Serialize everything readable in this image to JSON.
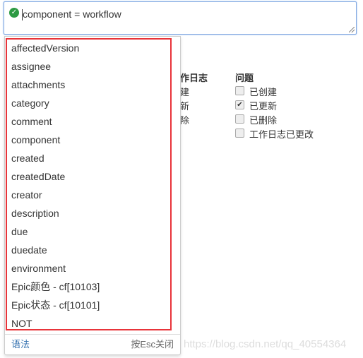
{
  "query": {
    "value": "component = workflow",
    "status_icon": "check-circle-icon",
    "status_color": "#2d9a43"
  },
  "background": {
    "worklog": {
      "header": "作日志",
      "items": [
        "建",
        "新",
        "除"
      ]
    },
    "issue": {
      "header": "问题",
      "items": [
        {
          "label": "已创建",
          "checked": false
        },
        {
          "label": "已更新",
          "checked": true
        },
        {
          "label": "已删除",
          "checked": false
        },
        {
          "label": "工作日志已更改",
          "checked": false
        }
      ]
    }
  },
  "suggestions": {
    "items": [
      "affectedVersion",
      "assignee",
      "attachments",
      "category",
      "comment",
      "component",
      "created",
      "createdDate",
      "creator",
      "description",
      "due",
      "duedate",
      "environment",
      "Epic颜色 - cf[10103]",
      "Epic状态 - cf[10101]",
      "NOT"
    ],
    "footer": {
      "syntax_link": "语法",
      "close_hint": "按Esc关闭"
    },
    "highlight_color": "#e8343a"
  },
  "watermark": "https://blog.csdn.net/qq_40554364"
}
